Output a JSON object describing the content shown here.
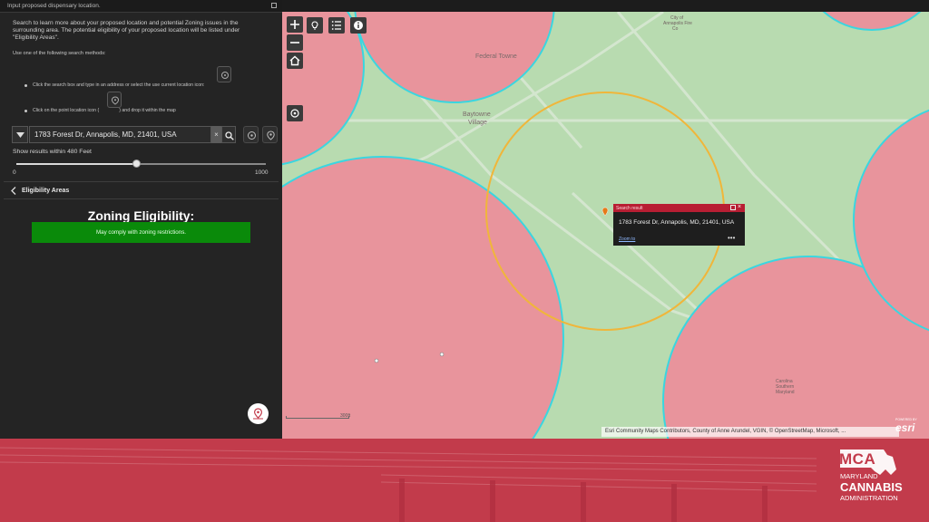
{
  "panel": {
    "header_title": "Input proposed dispensary location.",
    "intro_text": "Search to learn more about your proposed location and potential Zoning issues in the surrounding area. The potential eligibility of your proposed location will be listed under \"Eligibility Areas\".",
    "methods_label": "Use one of the following search methods:",
    "method_1": "Click the search box and type in an address or select the use current location icon:",
    "method_2": "Click on the point location icon (",
    "method_2_suffix": ") and drop it within the map",
    "search": {
      "value": "1783 Forest Dr, Annapolis, MD, 21401, USA",
      "clear_glyph": "×"
    },
    "radius": {
      "label": "Show results within 480 Feet",
      "min": "0",
      "max": "1000",
      "value": 480
    },
    "eligibility": {
      "section_title": "Eligibility Areas",
      "heading": "Zoning Eligibility:",
      "result": "May comply with zoning restrictions."
    }
  },
  "map": {
    "labels": {
      "federal_towne": "Federal Towne",
      "baytowne": "Baytowne",
      "village": "Village",
      "city_of_annapolis_1": "City of",
      "city_of_annapolis_2": "Annapolis Fire",
      "city_of_annapolis_3": "Co",
      "college_1": "Carolina",
      "college_2": "Southern",
      "college_3": "Maryland"
    },
    "popup": {
      "title": "Search result",
      "address": "1783 Forest Dr, Annapolis, MD, 21401, USA",
      "zoom_link": "Zoom to",
      "more": "•••"
    },
    "scale": "300ft",
    "attribution": "Esri Community Maps Contributors, County of Anne Arundel, VGIN, © OpenStreetMap, Microsoft, ...",
    "esri_powered": "POWERED BY",
    "esri_logo": "esri",
    "colors": {
      "restricted": "#e8949c",
      "eligible": "#b8dbb0",
      "buffer_edge": "#3ad6e0",
      "search_radius": "#f0b63a"
    }
  },
  "footer": {
    "abbr": "MCA",
    "line1": "MARYLAND",
    "line2": "CANNABIS",
    "line3": "ADMINISTRATION",
    "color": "#c23b4b"
  }
}
